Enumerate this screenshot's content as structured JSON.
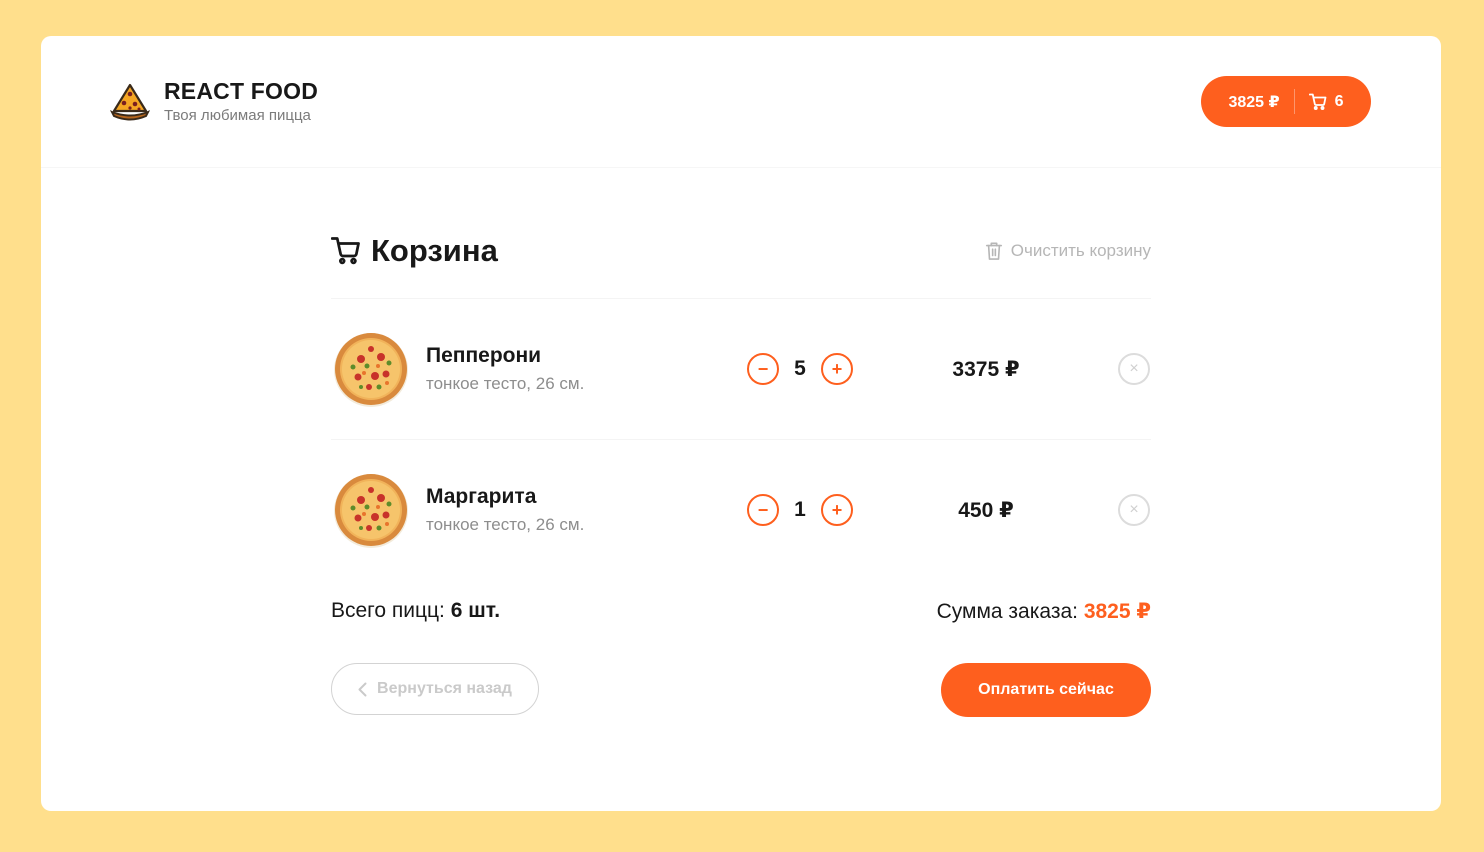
{
  "header": {
    "title": "REACT FOOD",
    "subtitle": "Твоя любимая пицца",
    "cart_price": "3825 ₽",
    "cart_count": "6"
  },
  "cart": {
    "title": "Корзина",
    "clear_label": "Очистить корзину",
    "items": [
      {
        "name": "Пепперони",
        "desc": "тонкое тесто, 26 см.",
        "count": "5",
        "price": "3375 ₽",
        "minus": "−",
        "plus": "+",
        "remove": "×"
      },
      {
        "name": "Маргарита",
        "desc": "тонкое тесто, 26 см.",
        "count": "1",
        "price": "450 ₽",
        "minus": "−",
        "plus": "+",
        "remove": "×"
      }
    ],
    "total_count_label": "Всего пицц:",
    "total_count_value": "6 шт.",
    "total_sum_label": "Сумма заказа:",
    "total_sum_value": "3825 ₽",
    "back_label": "Вернуться назад",
    "pay_label": "Оплатить сейчас"
  },
  "colors": {
    "accent": "#fe5f1e",
    "background": "#ffdf8c"
  },
  "icons": [
    "pizza-logo-icon",
    "cart-icon",
    "trash-icon",
    "chevron-left-icon",
    "close-icon"
  ]
}
